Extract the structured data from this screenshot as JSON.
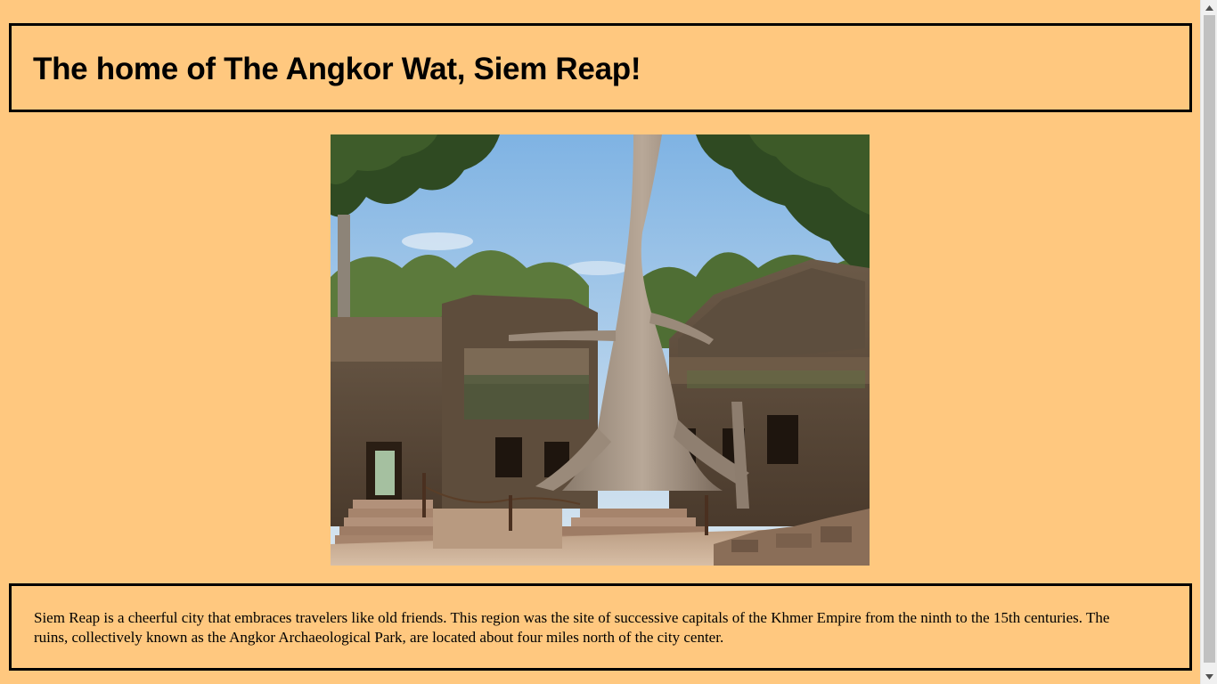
{
  "header": {
    "title": "The home of The Angkor Wat, Siem Reap!"
  },
  "main_image": {
    "alt": "Ta Prohm temple ruins with giant tree roots, Angkor"
  },
  "description": {
    "text": "Siem Reap is a cheerful city that embraces travelers like old friends. This region was the site of successive capitals of the Khmer Empire from the ninth to the 15th centuries. The ruins, collectively known as the Angkor Archaeological Park, are located about four miles north of the city center."
  },
  "colors": {
    "page_background": "#ffc87f",
    "border": "#000000",
    "scrollbar_track": "#f0f0f0",
    "scrollbar_thumb": "#c1c1c1"
  },
  "icons": {
    "scroll_up": "scroll-up-arrow-icon",
    "scroll_down": "scroll-down-arrow-icon"
  }
}
